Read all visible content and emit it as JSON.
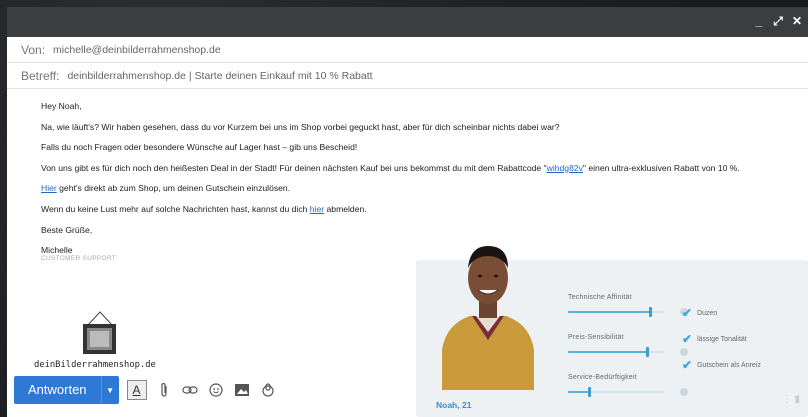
{
  "window": {
    "controls": [
      "_",
      "⤢",
      "✕"
    ]
  },
  "header": {
    "from_label": "Von:",
    "from_value": "michelle@deinbilderrahmenshop.de",
    "subject_label": "Betreff:",
    "subject_value": "deinbilderrahmenshop.de | Starte deinen Einkauf mit 10 % Rabatt"
  },
  "email": {
    "greeting": "Hey Noah,",
    "p1": "Na, wie läuft's? Wir haben gesehen, dass du vor Kurzem bei uns im Shop vorbei geguckt hast, aber für dich scheinbar nichts dabei war?",
    "p2": "Falls du noch Fragen oder besondere Wünsche auf Lager hast – gib uns Bescheid!",
    "p3_before": "Von uns gibt es für dich noch  den heißesten Deal in der Stadt! Für deinen nächsten Kauf bei uns bekommst du mit dem Rabattcode  \"",
    "p3_code": "wihdg82v",
    "p3_after": "\" einen ultra-exklusiven Rabatt von 10 %.",
    "p4_link": "Hier",
    "p4_text": " geht's direkt ab zum Shop, um deinen Gutschein einzulösen.",
    "p5_text": "Wenn du keine Lust mehr auf solche Nachrichten hast, kannst du dich ",
    "p5_link": "hier",
    "p5_after": " abmelden.",
    "closing": "Beste Grüße,",
    "signature_name": "Michelle",
    "signature_role": "CUSTOMER SUPPORT",
    "logo_text": "deinBilderrahmenshop.de"
  },
  "toolbar": {
    "reply_label": "Antworten",
    "icons": [
      "format-text-icon",
      "attachment-icon",
      "link-icon",
      "emoji-icon",
      "image-icon",
      "lock-icon"
    ]
  },
  "profile_card": {
    "name": "Noah, 21",
    "metrics": [
      {
        "label": "Technische Affinität",
        "value": 0.85
      },
      {
        "label": "Preis-Sensibilität",
        "value": 0.82
      },
      {
        "label": "Service-Bedürftigkeit",
        "value": 0.22
      }
    ],
    "tags": [
      "Duzen",
      "lässige Tonalität",
      "Gutschein als Anreiz"
    ],
    "accent_color": "#3da7d8"
  }
}
